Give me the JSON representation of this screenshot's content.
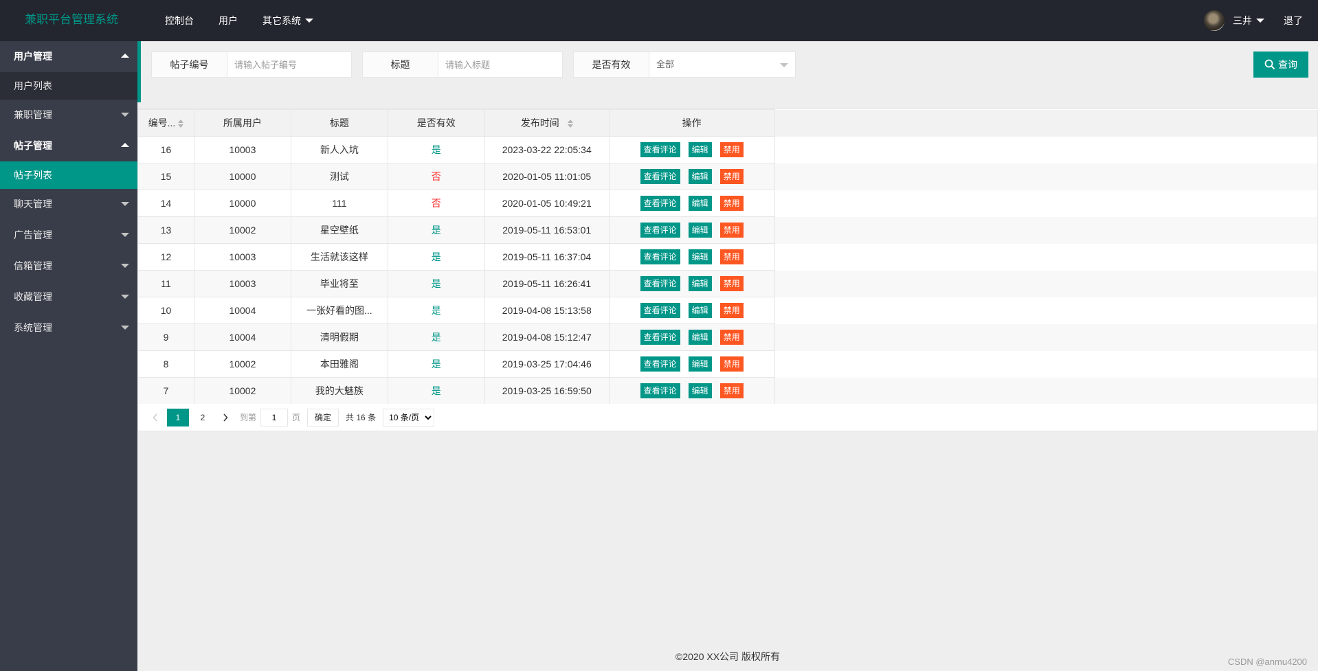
{
  "header": {
    "logo": "兼职平台管理系统",
    "nav": [
      "控制台",
      "用户",
      "其它系统"
    ],
    "user_name": "三井",
    "logout": "退了"
  },
  "sidebar": {
    "groups": [
      {
        "label": "用户管理",
        "open": true,
        "subs": [
          "用户列表"
        ]
      },
      {
        "label": "兼职管理",
        "open": false
      },
      {
        "label": "帖子管理",
        "open": true,
        "subs": [
          "帖子列表"
        ]
      },
      {
        "label": "聊天管理",
        "open": false
      },
      {
        "label": "广告管理",
        "open": false
      },
      {
        "label": "信箱管理",
        "open": false
      },
      {
        "label": "收藏管理",
        "open": false
      },
      {
        "label": "系统管理",
        "open": false
      }
    ],
    "active_sub": "帖子列表"
  },
  "search": {
    "post_id_label": "帖子编号",
    "post_id_placeholder": "请输入帖子编号",
    "title_label": "标题",
    "title_placeholder": "请输入标题",
    "valid_label": "是否有效",
    "valid_value": "全部",
    "query_button": "查询"
  },
  "table": {
    "headers": [
      "编号...",
      "所属用户",
      "标题",
      "是否有效",
      "发布时间",
      "操作"
    ],
    "actions": [
      "查看评论",
      "编辑",
      "禁用"
    ],
    "rows": [
      {
        "id": "16",
        "user": "10003",
        "title": "新人入坑",
        "valid": "是",
        "time": "2023-03-22 22:05:34"
      },
      {
        "id": "15",
        "user": "10000",
        "title": "测试",
        "valid": "否",
        "time": "2020-01-05 11:01:05"
      },
      {
        "id": "14",
        "user": "10000",
        "title": "111",
        "valid": "否",
        "time": "2020-01-05 10:49:21"
      },
      {
        "id": "13",
        "user": "10002",
        "title": "星空壁纸",
        "valid": "是",
        "time": "2019-05-11 16:53:01"
      },
      {
        "id": "12",
        "user": "10003",
        "title": "生活就该这样",
        "valid": "是",
        "time": "2019-05-11 16:37:04"
      },
      {
        "id": "11",
        "user": "10003",
        "title": "毕业将至",
        "valid": "是",
        "time": "2019-05-11 16:26:41"
      },
      {
        "id": "10",
        "user": "10004",
        "title": "一张好看的图...",
        "valid": "是",
        "time": "2019-04-08 15:13:58"
      },
      {
        "id": "9",
        "user": "10004",
        "title": "清明假期",
        "valid": "是",
        "time": "2019-04-08 15:12:47"
      },
      {
        "id": "8",
        "user": "10002",
        "title": "本田雅阁",
        "valid": "是",
        "time": "2019-03-25 17:04:46"
      },
      {
        "id": "7",
        "user": "10002",
        "title": "我的大魅族",
        "valid": "是",
        "time": "2019-03-25 16:59:50"
      }
    ]
  },
  "pagination": {
    "pages": [
      "1",
      "2"
    ],
    "current": "1",
    "goto_prefix": "到第",
    "goto_value": "1",
    "goto_suffix": "页",
    "confirm": "确定",
    "total": "共 16 条",
    "page_size": "10 条/页"
  },
  "footer": "©2020 XX公司 版权所有",
  "watermark": "CSDN @anmu4200",
  "colors": {
    "accent": "#009688",
    "danger": "#ff5722",
    "header_bg": "#23262e",
    "sidebar_bg": "#393d49"
  }
}
